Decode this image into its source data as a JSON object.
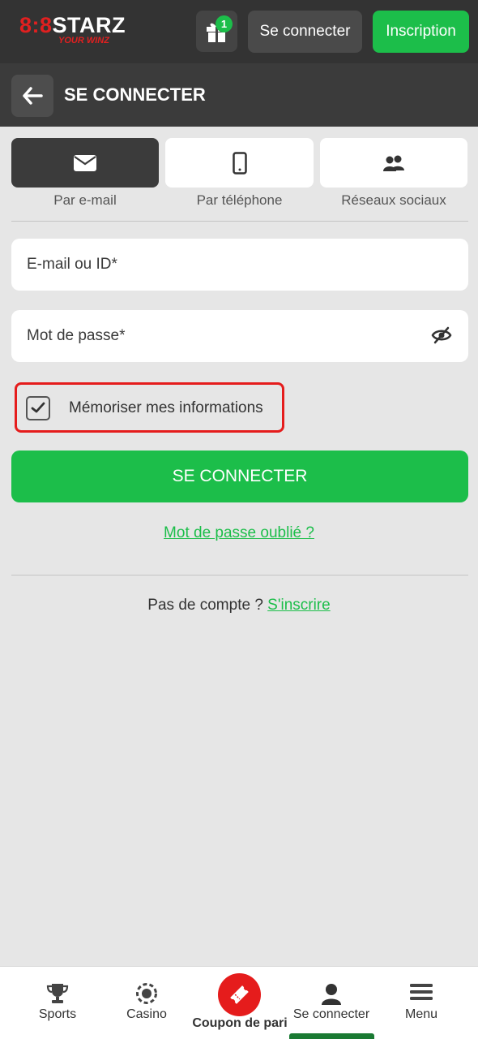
{
  "header": {
    "logo_main_red": "8:8",
    "logo_main": "STARZ",
    "logo_sub": "YOUR WINZ",
    "gift_badge_count": "1",
    "login_button": "Se connecter",
    "register_button": "Inscription"
  },
  "title_bar": {
    "title": "SE CONNECTER",
    "back_icon": "arrow-left-icon"
  },
  "login_methods": [
    {
      "label": "Par e-mail",
      "icon": "envelope-icon",
      "active": true
    },
    {
      "label": "Par téléphone",
      "icon": "phone-icon",
      "active": false
    },
    {
      "label": "Réseaux sociaux",
      "icon": "users-icon",
      "active": false
    }
  ],
  "form": {
    "email_placeholder": "E-mail ou ID*",
    "email_value": "",
    "password_placeholder": "Mot de passe*",
    "password_value": "",
    "remember_label": "Mémoriser mes informations",
    "remember_checked": true,
    "submit_label": "SE CONNECTER",
    "forgot_password": "Mot de passe oublié ?",
    "no_account_text": "Pas de compte ?",
    "signup_link": "S'inscrire"
  },
  "bottom_nav": {
    "items": [
      {
        "label": "Sports",
        "icon": "trophy-icon"
      },
      {
        "label": "Casino",
        "icon": "casino-chip-icon"
      },
      {
        "label": "Coupon de pari",
        "icon": "ticket-icon"
      },
      {
        "label": "Se connecter",
        "icon": "user-icon"
      },
      {
        "label": "Menu",
        "icon": "hamburger-icon"
      }
    ],
    "active": "Se connecter"
  },
  "colors": {
    "accent_green": "#1cbe4a",
    "header_dark": "#333333",
    "highlight_red": "#e51c1c",
    "background": "#e6e6e6"
  }
}
